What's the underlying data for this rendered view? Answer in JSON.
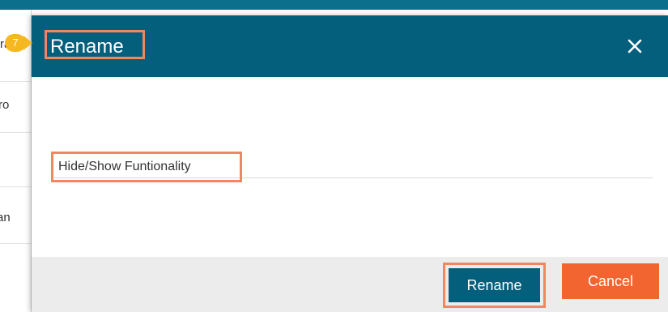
{
  "step_marker": {
    "number": "7"
  },
  "background": {
    "row_fragments": [
      "ra",
      "ro",
      "an"
    ]
  },
  "dialog": {
    "title": "Rename",
    "close_icon": "close-icon",
    "name_field": {
      "value": "Hide/Show Funtionality"
    },
    "buttons": {
      "rename": "Rename",
      "cancel": "Cancel"
    }
  },
  "colors": {
    "header": "#045f7c",
    "highlight": "#f0875e",
    "cancel": "#f26531",
    "step_marker": "#f5b820"
  }
}
